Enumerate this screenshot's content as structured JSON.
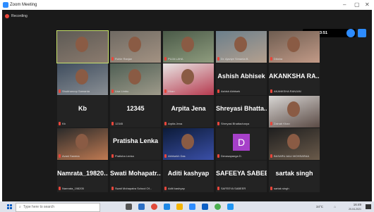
{
  "window": {
    "title": "Zoom Meeting"
  },
  "recording": {
    "label": "Recording"
  },
  "timer": {
    "value": "00:43:51"
  },
  "participants": [
    {
      "name": "",
      "label": "",
      "type": "video"
    },
    {
      "name": "",
      "label": "Ruhie Ranjan",
      "type": "video"
    },
    {
      "name": "",
      "label": "PUJA LAHA",
      "type": "video"
    },
    {
      "name": "",
      "label": "Dr. Ajaviye Simanta B.",
      "type": "video"
    },
    {
      "name": "",
      "label": "Diksha",
      "type": "video"
    },
    {
      "name": "",
      "label": "Shubharoop Samanta",
      "type": "video"
    },
    {
      "name": "",
      "label": "Lisa Limbu",
      "type": "video"
    },
    {
      "name": "",
      "label": "Hiran",
      "type": "video"
    },
    {
      "name": "Ashish Abhisek",
      "label": "Ashish Abhisek",
      "type": "name"
    },
    {
      "name": "AKANKSHA RA...",
      "label": "AKANKSHA RANJAN",
      "type": "name"
    },
    {
      "name": "Kb",
      "label": "Kb",
      "type": "name"
    },
    {
      "name": "12345",
      "label": "12345",
      "type": "name"
    },
    {
      "name": "Arpita Jena",
      "label": "Arpita Jena",
      "type": "name"
    },
    {
      "name": "Shreyasi Bhatta...",
      "label": "Shreyasi Bhattacharya",
      "type": "name"
    },
    {
      "name": "",
      "label": "Zainab Khan",
      "type": "video"
    },
    {
      "name": "",
      "label": "Avani Saxena",
      "type": "video"
    },
    {
      "name": "Pratisha Lenka",
      "label": "Pratisha Lenka",
      "type": "name"
    },
    {
      "name": "",
      "label": "Abhisekh Das",
      "type": "video"
    },
    {
      "name": "D",
      "label": "Devasapanga D.",
      "type": "avatar"
    },
    {
      "name": "",
      "label": "BASARU AALI MOHSARAA",
      "type": "video"
    },
    {
      "name": "Namrata_19820...",
      "label": "Namrata_198205",
      "type": "name"
    },
    {
      "name": "Swati Mohapatr...",
      "label": "Swati Mohapatra School Of...",
      "type": "name"
    },
    {
      "name": "Aditi kashyap",
      "label": "Aditi kashyap",
      "type": "name"
    },
    {
      "name": "SAFEEYA SABEER",
      "label": "SAFEEYA SABEER",
      "type": "name"
    },
    {
      "name": "sartak singh",
      "label": "sartak singh",
      "type": "name"
    }
  ],
  "taskbar": {
    "search_placeholder": "Type here to search",
    "temperature": "34°C",
    "time": "16:49",
    "date": "20-04-2021"
  },
  "colors": {
    "accent": "#2d8cff",
    "record": "#e8463b",
    "active_speaker": "#c8e36b",
    "tile_bg": "#232323"
  }
}
